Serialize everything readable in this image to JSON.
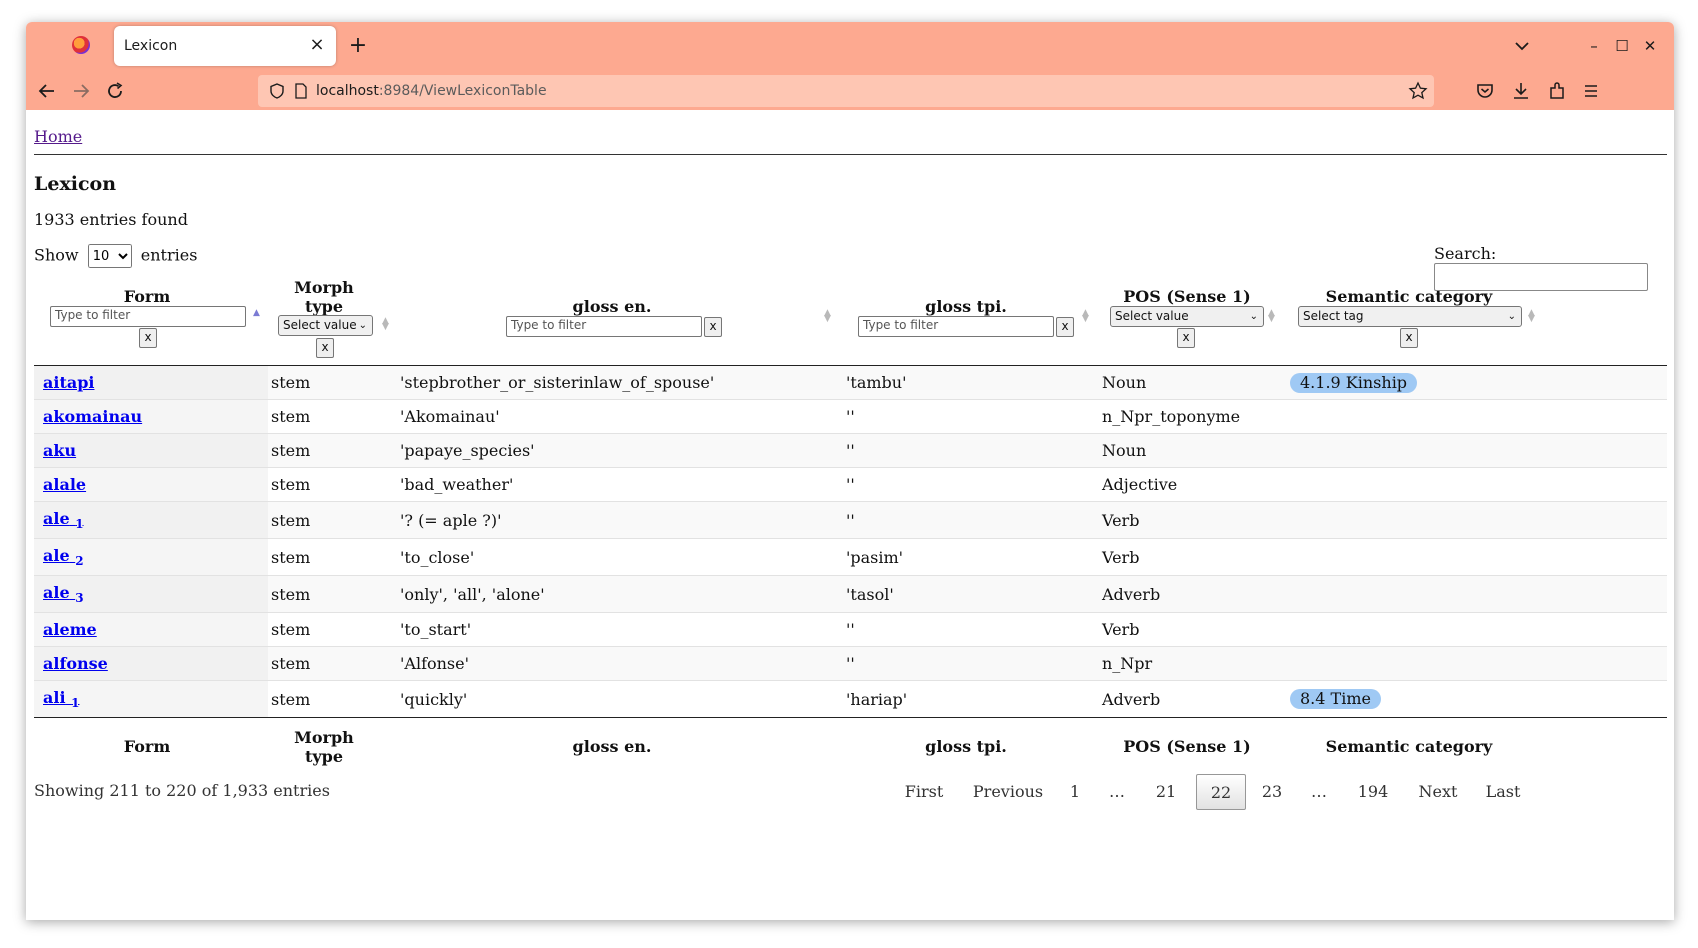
{
  "browser": {
    "tab_title": "Lexicon",
    "tab_close": "×",
    "new_tab": "+",
    "url_host": "localhost",
    "url_rest": ":8984/ViewLexiconTable",
    "window_controls": [
      "–",
      "☐",
      "✕"
    ]
  },
  "nav": {
    "home_label": "Home"
  },
  "page": {
    "title": "Lexicon",
    "entries_found": "1933 entries found",
    "show_label": "Show",
    "entries_label": "entries",
    "page_size": "10",
    "search_label": "Search:"
  },
  "columns": {
    "form": "Form",
    "morph_type_l1": "Morph",
    "morph_type_l2": "type",
    "gloss_en": "gloss en.",
    "gloss_tpi": "gloss tpi.",
    "pos": "POS (Sense 1)",
    "semantic": "Semantic category"
  },
  "filters": {
    "text_placeholder": "Type to filter",
    "select_value": "Select value",
    "select_tag": "Select tag",
    "clear": "x"
  },
  "rows": [
    {
      "form": "aitapi",
      "sub": "",
      "morph": "stem",
      "gloss_en": "'stepbrother_or_sisterinlaw_of_spouse'",
      "gloss_tpi": "'tambu'",
      "pos": "Noun",
      "sem": "4.1.9 Kinship"
    },
    {
      "form": "akomainau",
      "sub": "",
      "morph": "stem",
      "gloss_en": "'Akomainau'",
      "gloss_tpi": "''",
      "pos": "n_Npr_toponyme",
      "sem": ""
    },
    {
      "form": "aku",
      "sub": "",
      "morph": "stem",
      "gloss_en": "'papaye_species'",
      "gloss_tpi": "''",
      "pos": "Noun",
      "sem": ""
    },
    {
      "form": "alale",
      "sub": "",
      "morph": "stem",
      "gloss_en": "'bad_weather'",
      "gloss_tpi": "''",
      "pos": "Adjective",
      "sem": ""
    },
    {
      "form": "ale",
      "sub": "1",
      "morph": "stem",
      "gloss_en": "'? (= aple ?)'",
      "gloss_tpi": "''",
      "pos": "Verb",
      "sem": ""
    },
    {
      "form": "ale",
      "sub": "2",
      "morph": "stem",
      "gloss_en": "'to_close'",
      "gloss_tpi": "'pasim'",
      "pos": "Verb",
      "sem": ""
    },
    {
      "form": "ale",
      "sub": "3",
      "morph": "stem",
      "gloss_en": "'only', 'all', 'alone'",
      "gloss_tpi": "'tasol'",
      "pos": "Adverb",
      "sem": ""
    },
    {
      "form": "aleme",
      "sub": "",
      "morph": "stem",
      "gloss_en": "'to_start'",
      "gloss_tpi": "''",
      "pos": "Verb",
      "sem": ""
    },
    {
      "form": "alfonse",
      "sub": "",
      "morph": "stem",
      "gloss_en": "'Alfonse'",
      "gloss_tpi": "''",
      "pos": "n_Npr",
      "sem": ""
    },
    {
      "form": "ali",
      "sub": "1",
      "morph": "stem",
      "gloss_en": "'quickly'",
      "gloss_tpi": "'hariap'",
      "pos": "Adverb",
      "sem": "8.4 Time"
    }
  ],
  "footer": {
    "info": "Showing 211 to 220 of 1,933 entries",
    "pager": {
      "first": "First",
      "previous": "Previous",
      "p1": "1",
      "ell1": "…",
      "p21": "21",
      "p22": "22",
      "p23": "23",
      "ell2": "…",
      "p194": "194",
      "next": "Next",
      "last": "Last"
    }
  }
}
